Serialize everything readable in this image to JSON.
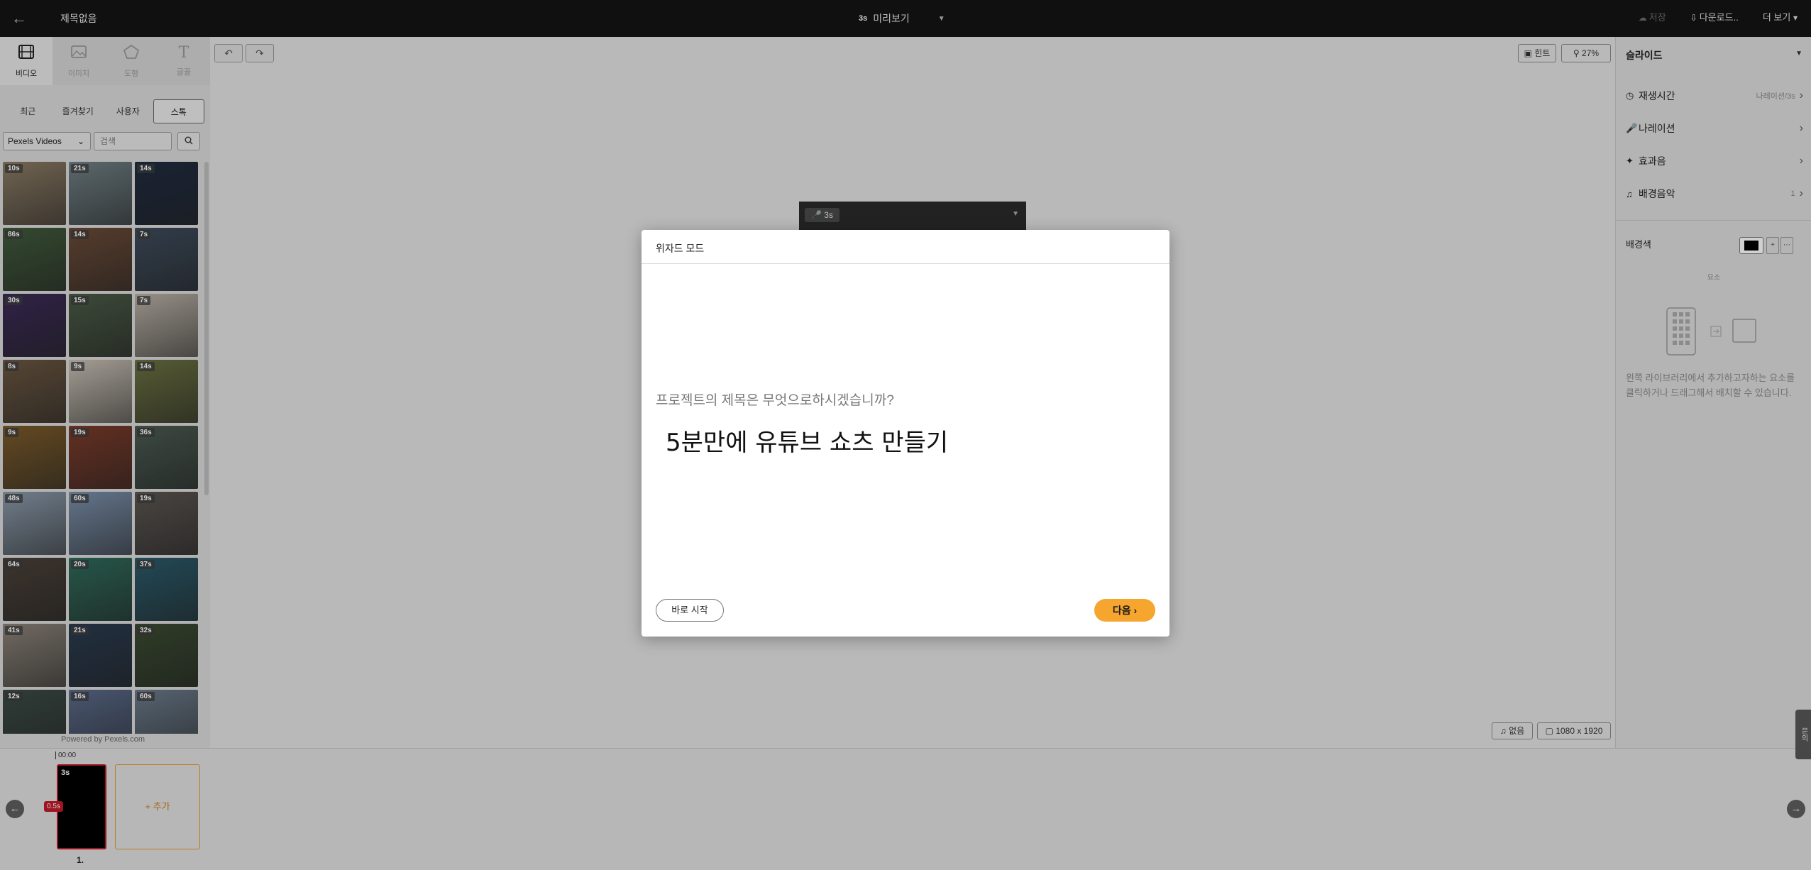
{
  "header": {
    "title": "제목없음",
    "preview_badge": "3s",
    "preview_label": "미리보기",
    "save": "저장",
    "download": "다운로드..",
    "more": "더 보기"
  },
  "left_panel": {
    "categories": [
      {
        "label": "비디오",
        "icon": "film-icon"
      },
      {
        "label": "이미지",
        "icon": "image-icon"
      },
      {
        "label": "도형",
        "icon": "pentagon-icon"
      },
      {
        "label": "글꼴",
        "icon": "text-icon"
      }
    ],
    "subtabs": [
      "최근",
      "즐겨찾기",
      "사용자",
      "스톡"
    ],
    "source_select": "Pexels Videos",
    "search_placeholder": "검색",
    "thumbnails": [
      {
        "duration": "10s",
        "color": "#8a7a63"
      },
      {
        "duration": "21s",
        "color": "#6f7f84"
      },
      {
        "duration": "14s",
        "color": "#1f2b3f"
      },
      {
        "duration": "86s",
        "color": "#3f5a3a"
      },
      {
        "duration": "14s",
        "color": "#6a4a37"
      },
      {
        "duration": "7s",
        "color": "#3d4b5b"
      },
      {
        "duration": "30s",
        "color": "#3a2a55"
      },
      {
        "duration": "15s",
        "color": "#4a5a45"
      },
      {
        "duration": "7s",
        "color": "#b8b0a5"
      },
      {
        "duration": "8s",
        "color": "#6a5640"
      },
      {
        "duration": "9s",
        "color": "#c8c0b4"
      },
      {
        "duration": "14s",
        "color": "#6a7040"
      },
      {
        "duration": "9s",
        "color": "#7a5a2a"
      },
      {
        "duration": "19s",
        "color": "#7a3a2a"
      },
      {
        "duration": "36s",
        "color": "#4a5a50"
      },
      {
        "duration": "48s",
        "color": "#8a9aaa"
      },
      {
        "duration": "60s",
        "color": "#7a8faa"
      },
      {
        "duration": "19s",
        "color": "#5a5550"
      },
      {
        "duration": "64s",
        "color": "#4a4038"
      },
      {
        "duration": "20s",
        "color": "#2f6a5a"
      },
      {
        "duration": "37s",
        "color": "#2a5a6a"
      },
      {
        "duration": "41s",
        "color": "#8a8278"
      },
      {
        "duration": "21s",
        "color": "#2a3a4f"
      },
      {
        "duration": "32s",
        "color": "#3a4a30"
      },
      {
        "duration": "12s",
        "color": "#3a4a45"
      },
      {
        "duration": "16s",
        "color": "#5a6a8a"
      },
      {
        "duration": "60s",
        "color": "#6a7a8a"
      }
    ],
    "powered_by": "Powered by Pexels.com"
  },
  "canvas": {
    "hint_label": "힌트",
    "zoom_label": "27%",
    "slide_duration": "3s",
    "music_label": "없음",
    "size_label": "1080 x 1920"
  },
  "right_panel": {
    "header": "슬라이드",
    "rows": [
      {
        "label": "재생시간",
        "value": "나레이션/3s",
        "icon": "clock-icon"
      },
      {
        "label": "나레이션",
        "value": "",
        "icon": "mic-icon"
      },
      {
        "label": "효과음",
        "value": "",
        "icon": "sparkle-icon"
      },
      {
        "label": "배경음악",
        "value": "1",
        "icon": "music-note-icon"
      }
    ],
    "bg_color_label": "배경색",
    "bg_color": "#000000",
    "elements_label": "요소",
    "elements_help": "왼쪽 라이브러리에서 추가하고자하는 요소를 클릭하거나 드래그해서 배치할 수 있습니다."
  },
  "timeline": {
    "time": "00:00",
    "scene_duration": "3s",
    "transition": "0.5s",
    "scene_number": "1.",
    "add_label": "+ 추가",
    "side_tab": "문의"
  },
  "modal": {
    "title": "위자드 모드",
    "question": "프로젝트의 제목은 무엇으로하시겠습니까?",
    "title_value": "5분만에 유튜브 쇼츠 만들기",
    "start_button": "바로 시작",
    "next_button": "다음"
  },
  "colors": {
    "accent": "#f6a52e",
    "scene_border": "#c0192a"
  }
}
